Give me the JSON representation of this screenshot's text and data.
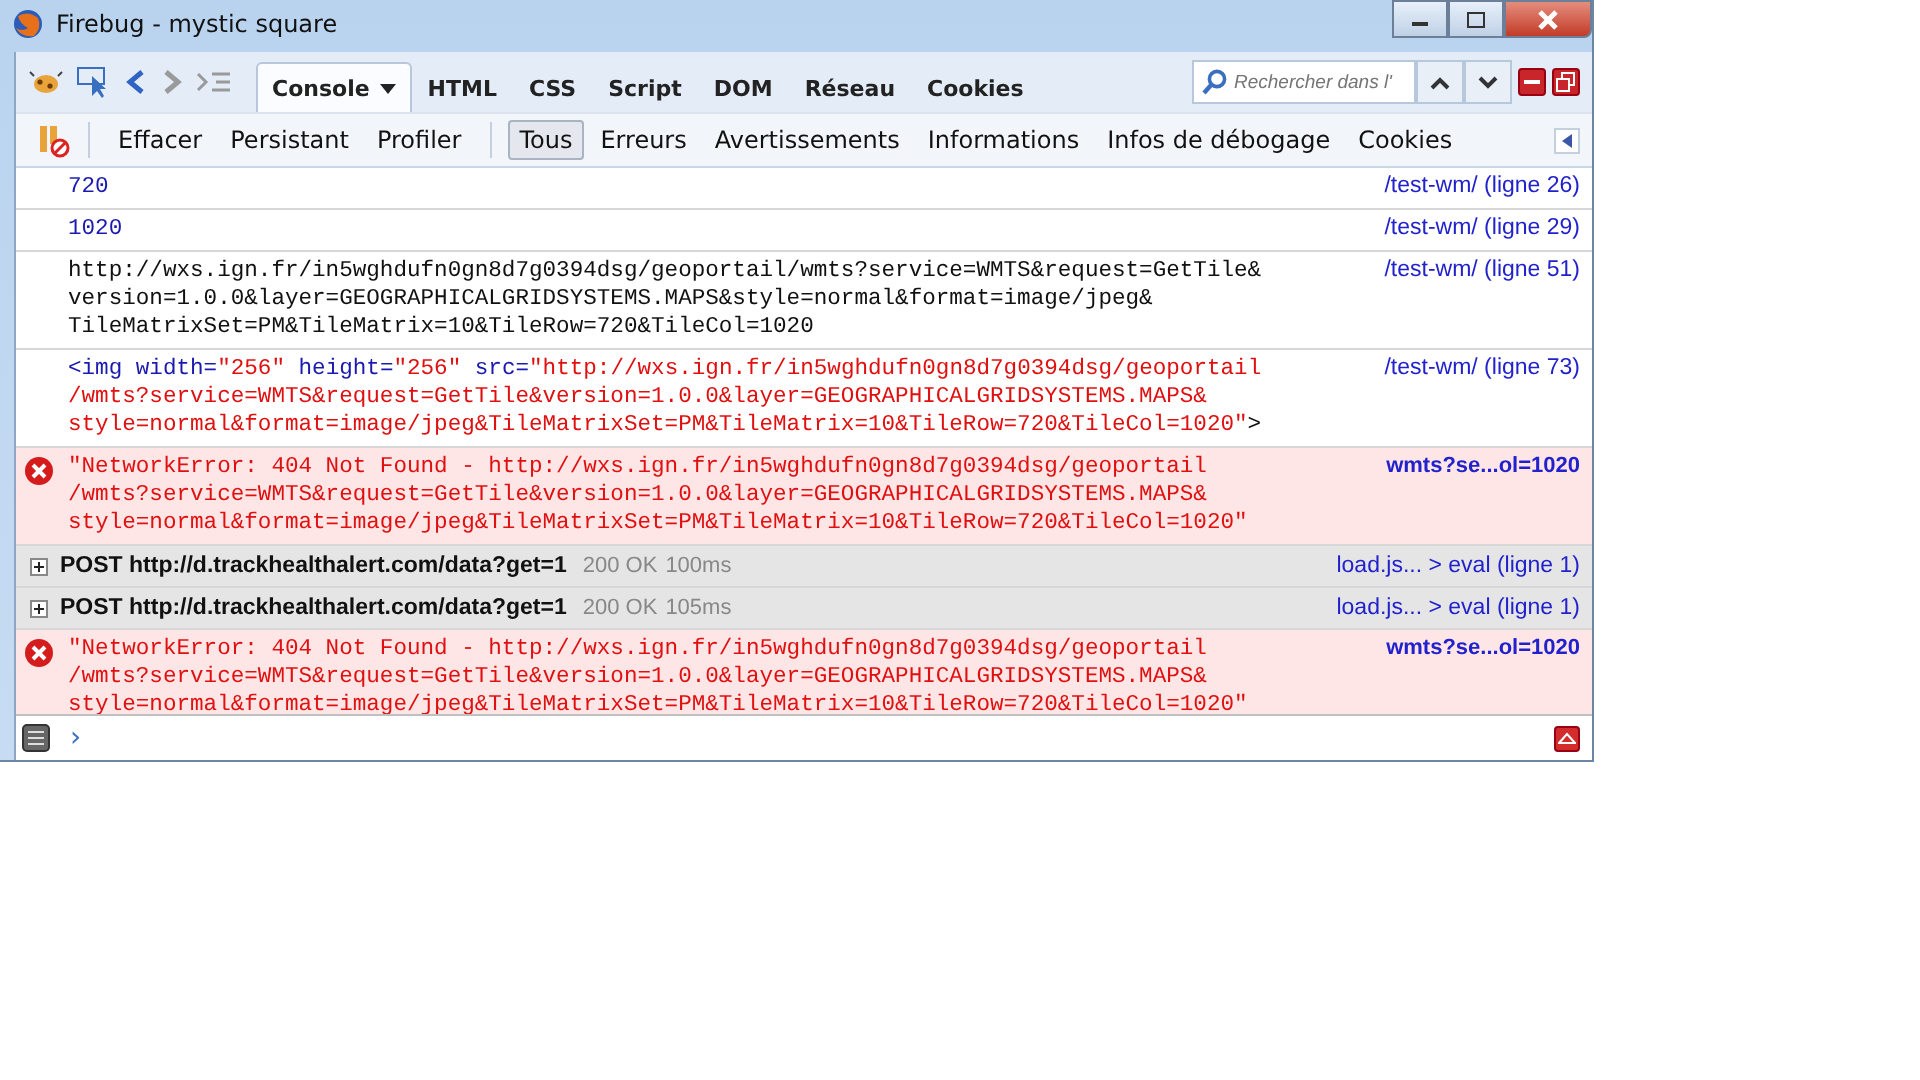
{
  "window": {
    "title": "Firebug - mystic square"
  },
  "panel_tabs": [
    {
      "label": "Console",
      "selected": true,
      "dropdown": true
    },
    {
      "label": "HTML",
      "selected": false,
      "dropdown": false
    },
    {
      "label": "CSS",
      "selected": false,
      "dropdown": false
    },
    {
      "label": "Script",
      "selected": false,
      "dropdown": false
    },
    {
      "label": "DOM",
      "selected": false,
      "dropdown": false
    },
    {
      "label": "Réseau",
      "selected": false,
      "dropdown": false
    },
    {
      "label": "Cookies",
      "selected": false,
      "dropdown": false
    }
  ],
  "search": {
    "placeholder": "Rechercher dans l'"
  },
  "console_actions": [
    "Effacer",
    "Persistant",
    "Profiler"
  ],
  "filters": [
    {
      "label": "Tous",
      "selected": true
    },
    {
      "label": "Erreurs",
      "selected": false
    },
    {
      "label": "Avertissements",
      "selected": false
    },
    {
      "label": "Informations",
      "selected": false
    },
    {
      "label": "Infos de débogage",
      "selected": false
    },
    {
      "label": "Cookies",
      "selected": false
    }
  ],
  "log": [
    {
      "kind": "number",
      "lines": [
        [
          {
            "kind": "number",
            "text": "720"
          }
        ]
      ],
      "source": "/test-wm/ (ligne 26)"
    },
    {
      "kind": "number",
      "lines": [
        [
          {
            "kind": "number",
            "text": "1020"
          }
        ]
      ],
      "source": "/test-wm/ (ligne 29)"
    },
    {
      "kind": "text",
      "lines": [
        [
          {
            "kind": "plain",
            "text": "http://wxs.ign.fr/in5wghdufn0gn8d7g0394dsg/geoportail/wmts?service=WMTS&request=GetTile&"
          }
        ],
        [
          {
            "kind": "plain",
            "text": "version=1.0.0&layer=GEOGRAPHICALGRIDSYSTEMS.MAPS&style=normal&format=image/jpeg&"
          }
        ],
        [
          {
            "kind": "plain",
            "text": "TileMatrixSet=PM&TileMatrix=10&TileRow=720&TileCol=1020"
          }
        ]
      ],
      "source": "/test-wm/ (ligne 51)"
    },
    {
      "kind": "element",
      "lines": [
        [
          {
            "kind": "markup",
            "text": "<img width="
          },
          {
            "kind": "string",
            "text": "\"256\""
          },
          {
            "kind": "markup",
            "text": " height="
          },
          {
            "kind": "string",
            "text": "\"256\""
          },
          {
            "kind": "markup",
            "text": " src="
          },
          {
            "kind": "string",
            "text": "\"http://wxs.ign.fr/in5wghdufn0gn8d7g0394dsg/geoportail"
          }
        ],
        [
          {
            "kind": "string",
            "text": "/wmts?service=WMTS&request=GetTile&version=1.0.0&layer=GEOGRAPHICALGRIDSYSTEMS.MAPS&"
          }
        ],
        [
          {
            "kind": "string",
            "text": "style=normal&format=image/jpeg&TileMatrixSet=PM&TileMatrix=10&TileRow=720&TileCol=1020\""
          },
          {
            "kind": "plain",
            "text": ">"
          }
        ]
      ],
      "source": "/test-wm/ (ligne 73)"
    },
    {
      "kind": "error",
      "lines": [
        [
          {
            "kind": "string",
            "text": "\"NetworkError: 404 Not Found - http://wxs.ign.fr/in5wghdufn0gn8d7g0394dsg/geoportail"
          }
        ],
        [
          {
            "kind": "string",
            "text": "/wmts?service=WMTS&request=GetTile&version=1.0.0&layer=GEOGRAPHICALGRIDSYSTEMS.MAPS&"
          }
        ],
        [
          {
            "kind": "string",
            "text": "style=normal&format=image/jpeg&TileMatrixSet=PM&TileMatrix=10&TileRow=720&TileCol=1020\""
          }
        ]
      ],
      "source": "wmts?se...ol=1020"
    },
    {
      "kind": "request",
      "expanded": false,
      "request": "POST http://d.trackhealthalert.com/data?get=1",
      "status": "200 OK",
      "time": "100ms",
      "source": "load.js... > eval (ligne 1)"
    },
    {
      "kind": "request",
      "expanded": false,
      "request": "POST http://d.trackhealthalert.com/data?get=1",
      "status": "200 OK",
      "time": "105ms",
      "source": "load.js... > eval (ligne 1)"
    },
    {
      "kind": "error",
      "lines": [
        [
          {
            "kind": "string",
            "text": "\"NetworkError: 404 Not Found - http://wxs.ign.fr/in5wghdufn0gn8d7g0394dsg/geoportail"
          }
        ],
        [
          {
            "kind": "string",
            "text": "/wmts?service=WMTS&request=GetTile&version=1.0.0&layer=GEOGRAPHICALGRIDSYSTEMS.MAPS&"
          }
        ],
        [
          {
            "kind": "string",
            "text": "style=normal&format=image/jpeg&TileMatrixSet=PM&TileMatrix=10&TileRow=720&TileCol=1020\""
          }
        ]
      ],
      "source": "wmts?se...ol=1020"
    }
  ],
  "command_line": {
    "prompt": "›"
  }
}
